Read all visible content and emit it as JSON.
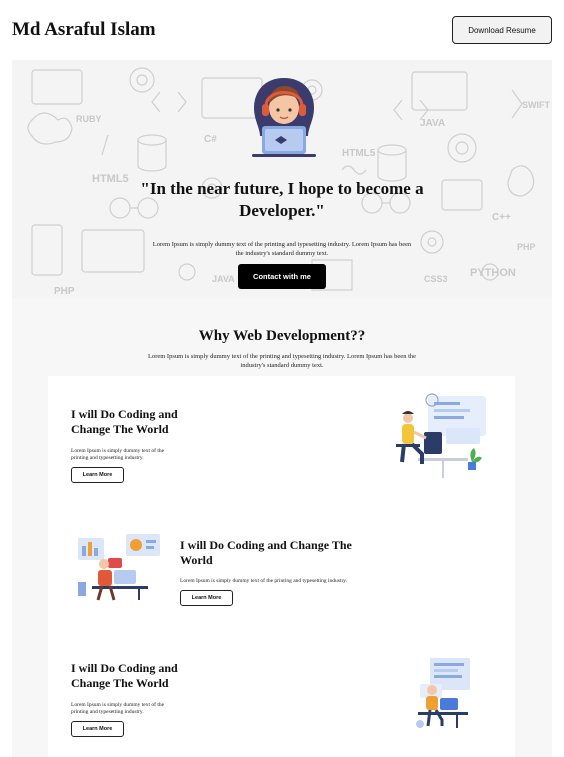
{
  "header": {
    "brand": "Md Asraful Islam",
    "resume_label": "Download Resume"
  },
  "hero": {
    "quote": "\"In the near future, I hope to become a Developer.\"",
    "subtext": "Lorem Ipsum is simply dummy text of the printing and typesetting industry. Lorem Ipsum has been the industry's standard dummy text.",
    "contact_label": "Contact with me",
    "doodle_words": [
      "RUBY",
      "JAVA",
      "HTML5",
      "CSS3",
      "PHP",
      "PYTHON",
      "C#",
      "C++",
      "SWIFT",
      "HTML5",
      "JAVA",
      "PHP"
    ]
  },
  "why": {
    "title": "Why Web Development??",
    "subtext": "Lorem Ipsum is simply dummy text of the printing and typesetting industry. Lorem Ipsum has been the industry's standard dummy text."
  },
  "cards": [
    {
      "title": "I will Do Coding and Change The World",
      "text": "Lorem Ipsum is simply dummy text of the printing and typesetting industry.",
      "button": "Learn More"
    },
    {
      "title": "I will Do Coding and Change The World",
      "text": "Lorem Ipsum is simply dummy text of the printing and typesetting industry.",
      "button": "Learn More"
    },
    {
      "title": "I will Do Coding and Change The World",
      "text": "Lorem Ipsum is simply dummy text of the printing and typesetting industry.",
      "button": "Learn More"
    }
  ],
  "colors": {
    "accent": "#000000",
    "illustration_blue": "#4a7bd8",
    "illustration_orange": "#f0a030"
  }
}
